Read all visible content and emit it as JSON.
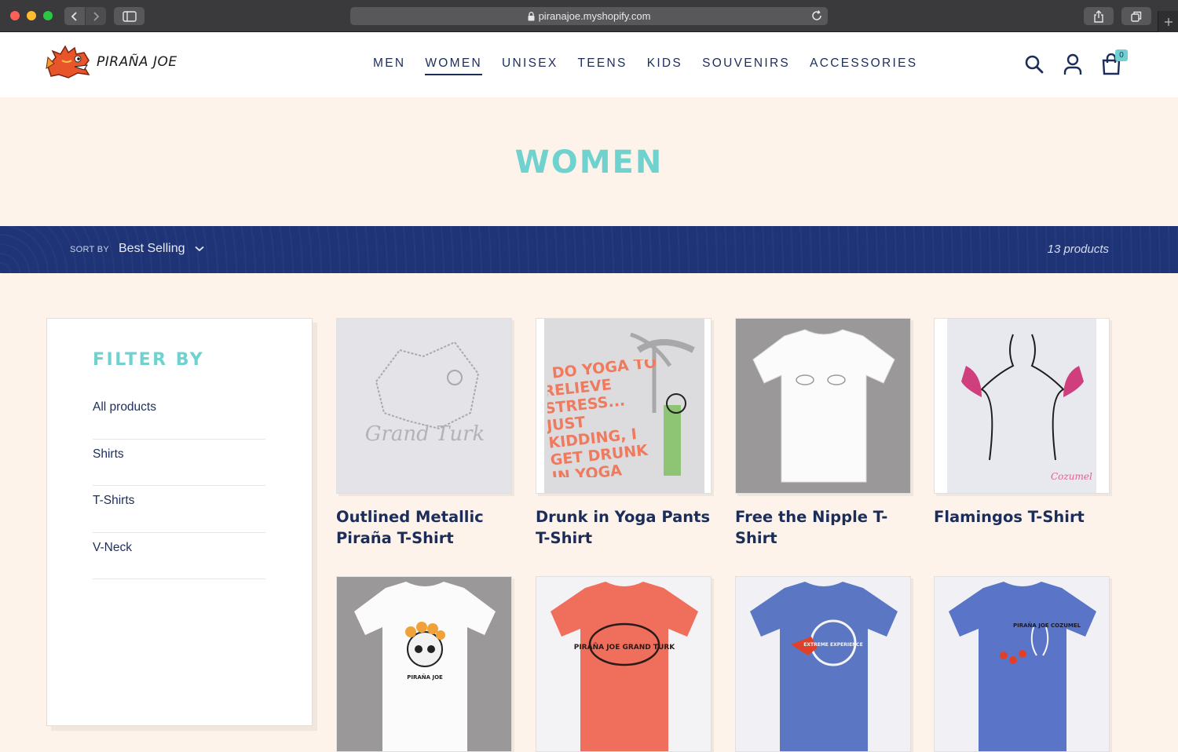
{
  "browser": {
    "url": "piranajoe.myshopify.com"
  },
  "header": {
    "logo_text": "PIRAÑA JOE",
    "nav": [
      {
        "label": "MEN"
      },
      {
        "label": "WOMEN",
        "active": true
      },
      {
        "label": "UNISEX"
      },
      {
        "label": "TEENS"
      },
      {
        "label": "KIDS"
      },
      {
        "label": "SOUVENIRS"
      },
      {
        "label": "ACCESSORIES"
      }
    ],
    "cart_count": "0",
    "icons": [
      "search-icon",
      "account-icon",
      "cart-icon"
    ]
  },
  "hero": {
    "title": "WOMEN"
  },
  "sort_bar": {
    "label": "SORT BY",
    "selected": "Best Selling",
    "count_text": "13 products"
  },
  "filter": {
    "title": "FILTER BY",
    "items": [
      "All products",
      "Shirts",
      "T-Shirts",
      "V-Neck"
    ]
  },
  "products": [
    {
      "title": "Outlined Metallic Piraña T-Shirt",
      "image_text": "Grand Turk"
    },
    {
      "title": "Drunk in Yoga Pants T-Shirt",
      "image_text": "I DO YOGA TO RELIEVE STRESS... JUST KIDDING, I GET DRUNK IN YOGA PANTS"
    },
    {
      "title": "Free the Nipple T-Shirt"
    },
    {
      "title": "Flamingos T-Shirt",
      "image_text": "Cozumel"
    },
    {
      "title": "",
      "image_text": "PIRAÑA JOE"
    },
    {
      "title": "",
      "image_text": "PIRAÑA JOE GRAND TURK"
    },
    {
      "title": "",
      "image_text": "EXTREME EXPERIENCE"
    },
    {
      "title": "",
      "image_text": "PIRAÑA JOE COZUMEL"
    }
  ],
  "colors": {
    "brand_navy": "#1c2d5a",
    "accent_teal": "#6fd2cf",
    "page_bg": "#fdf3ea",
    "sort_bar_bg": "#1e3477"
  }
}
